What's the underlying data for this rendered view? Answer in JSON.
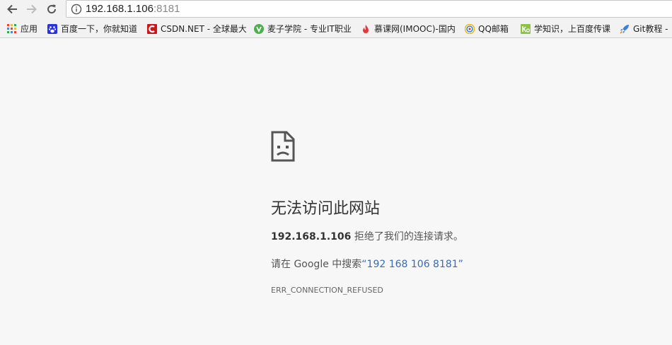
{
  "address_bar": {
    "url_host": "192.168.1.106",
    "url_port": ":8181"
  },
  "bookmarks": [
    {
      "label": "应用",
      "icon": "apps-grid-icon"
    },
    {
      "label": "百度一下，你就知道",
      "icon": "baidu-paw-icon"
    },
    {
      "label": "CSDN.NET - 全球最大",
      "icon": "csdn-icon"
    },
    {
      "label": "麦子学院 - 专业IT职业",
      "icon": "maiziedu-icon"
    },
    {
      "label": "慕课网(IMOOC)-国内",
      "icon": "imooc-flame-icon"
    },
    {
      "label": "QQ邮箱",
      "icon": "qqmail-icon"
    },
    {
      "label": "学知识，上百度传课",
      "icon": "chuanke-icon"
    },
    {
      "label": "Git教程 -",
      "icon": "rocket-icon"
    }
  ],
  "error": {
    "title": "无法访问此网站",
    "host": "192.168.1.106",
    "message": " 拒绝了我们的连接请求。",
    "search_prefix": "请在 Google 中搜索",
    "search_query": "“192 168 106 8181”",
    "code": "ERR_CONNECTION_REFUSED"
  }
}
